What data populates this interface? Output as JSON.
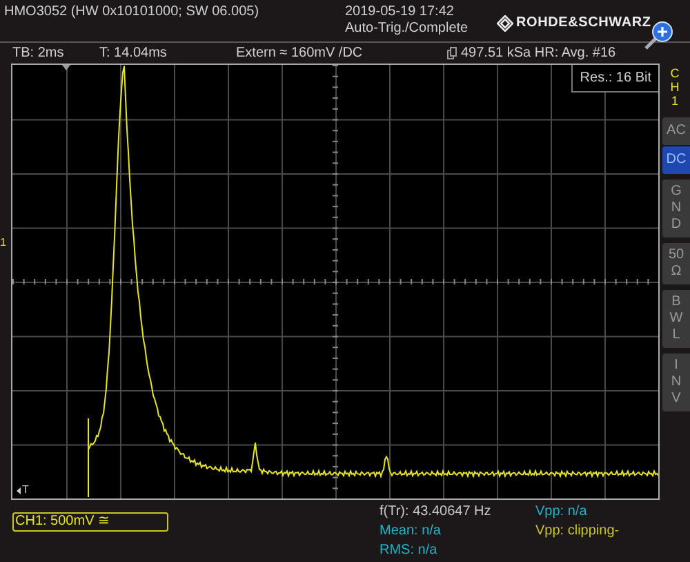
{
  "header": {
    "device_info": "HMO3052 (HW 0x10101000; SW 06.005)",
    "datetime": "2019-05-19 17:42",
    "trigger_status": "Auto-Trig./Complete",
    "logo": "ROHDE&SCHWARZ"
  },
  "status_bar": {
    "timebase": "TB: 2ms",
    "trigger_time": "T: 14.04ms",
    "trigger_source": "Extern ≈ 160mV /DC",
    "acquisition": "497.51 kSa HR: Avg. #16"
  },
  "display": {
    "resolution": "Res.: 16 Bit",
    "channel_marker": "1",
    "trigger_marker": "T"
  },
  "channel_panel": {
    "label": "CH1",
    "buttons": [
      {
        "label": "AC",
        "kind": "horizontal",
        "selected": false
      },
      {
        "label": "DC",
        "kind": "horizontal",
        "selected": true
      },
      {
        "label": "GND",
        "kind": "vertical",
        "selected": false
      },
      {
        "label": "50 Ω",
        "kind": "vertical",
        "selected": false
      },
      {
        "label": "BWL",
        "kind": "vertical",
        "selected": false
      },
      {
        "label": "INV",
        "kind": "vertical",
        "selected": false
      }
    ]
  },
  "channel_info": "CH1: 500mV ≅",
  "measurements": [
    {
      "text": "f(Tr): 43.40647 Hz",
      "color": "#c8c8c8"
    },
    {
      "text": "Vpp: n/a",
      "color": "#1eb4c8"
    },
    {
      "text": "Mean: n/a",
      "color": "#1eb4c8"
    },
    {
      "text": "Vpp: clipping-",
      "color": "#c8c81e"
    },
    {
      "text": "RMS: n/a",
      "color": "#1eb4c8"
    }
  ]
}
